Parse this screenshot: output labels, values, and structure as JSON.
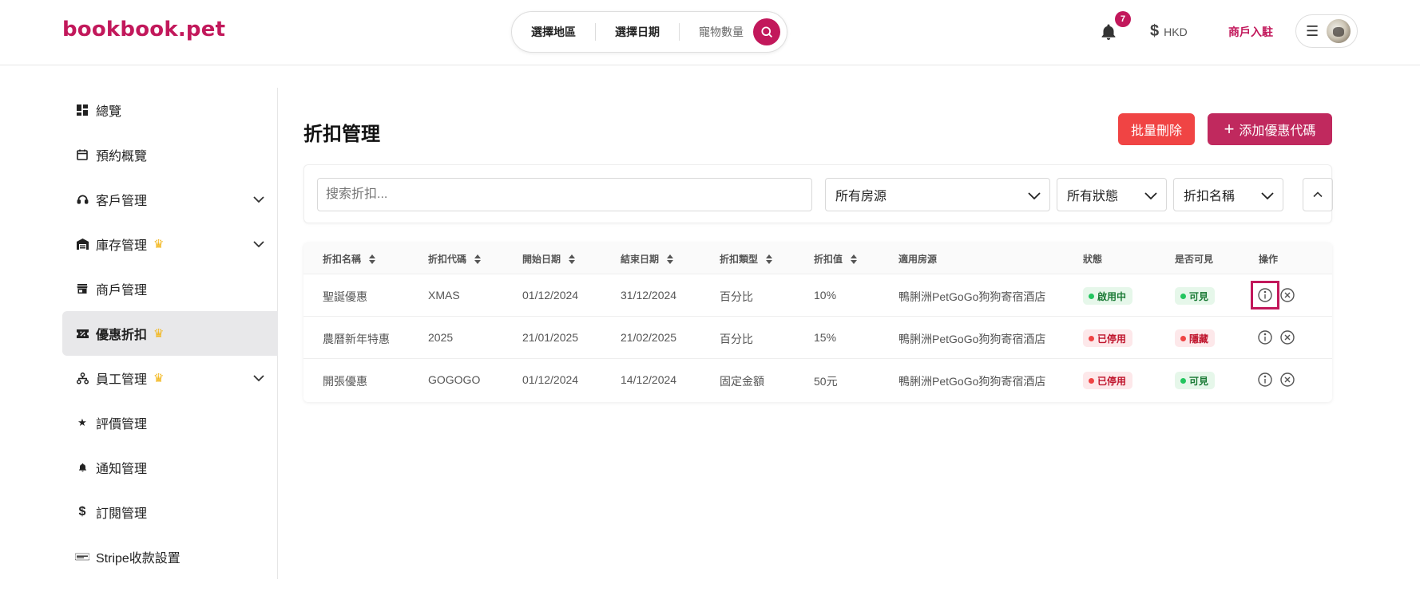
{
  "header": {
    "logo": "bookbook.pet",
    "search": {
      "region": "選擇地區",
      "date": "選擇日期",
      "pets": "寵物數量"
    },
    "notifications_count": "7",
    "currency": "HKD",
    "merchant_link": "商戶入駐"
  },
  "sidebar": {
    "items": [
      {
        "label": "總覽"
      },
      {
        "label": "預約概覽"
      },
      {
        "label": "客戶管理"
      },
      {
        "label": "庫存管理"
      },
      {
        "label": "商戶管理"
      },
      {
        "label": "優惠折扣"
      },
      {
        "label": "員工管理"
      },
      {
        "label": "評價管理"
      },
      {
        "label": "通知管理"
      },
      {
        "label": "訂閱管理"
      },
      {
        "label": "Stripe收款設置"
      }
    ],
    "active_index": 5
  },
  "main": {
    "title": "折扣管理",
    "bulk_delete": "批量刪除",
    "add_code": "添加優惠代碼",
    "search_placeholder": "搜索折扣...",
    "filters": {
      "property": "所有房源",
      "status": "所有狀態",
      "sort_by": "折扣名稱"
    }
  },
  "table": {
    "columns": [
      "折扣名稱",
      "折扣代碼",
      "開始日期",
      "結束日期",
      "折扣類型",
      "折扣值",
      "適用房源",
      "狀態",
      "是否可見",
      "操作"
    ],
    "rows": [
      {
        "name": "聖誕優惠",
        "code": "XMAS",
        "start": "01/12/2024",
        "end": "31/12/2024",
        "type": "百分比",
        "value": "10%",
        "property": "鴨脷洲PetGoGo狗狗寄宿酒店",
        "status": "啟用中",
        "visible": "可見"
      },
      {
        "name": "農曆新年特惠",
        "code": "2025",
        "start": "21/01/2025",
        "end": "21/02/2025",
        "type": "百分比",
        "value": "15%",
        "property": "鴨脷洲PetGoGo狗狗寄宿酒店",
        "status": "已停用",
        "visible": "隱藏"
      },
      {
        "name": "開張優惠",
        "code": "GOGOGO",
        "start": "01/12/2024",
        "end": "14/12/2024",
        "type": "固定金額",
        "value": "50元",
        "property": "鴨脷洲PetGoGo狗狗寄宿酒店",
        "status": "已停用",
        "visible": "可見"
      }
    ]
  },
  "colors": {
    "brand": "#c2185b",
    "danger": "#f04444",
    "success": "#22c55e"
  }
}
